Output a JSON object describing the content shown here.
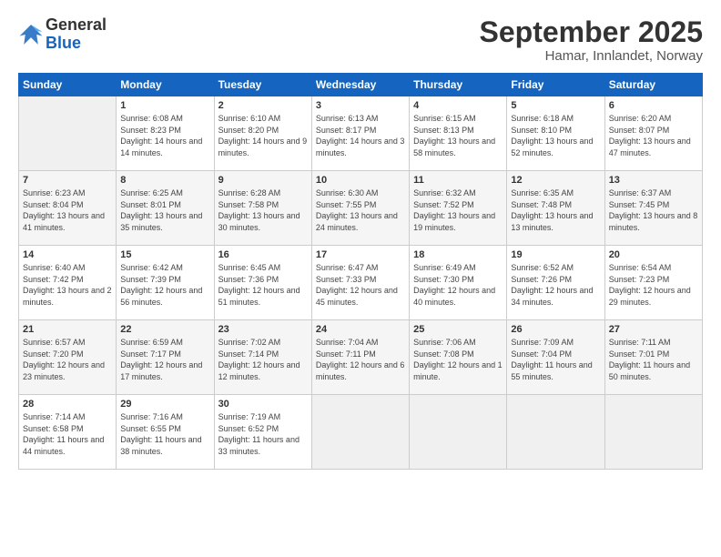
{
  "logo": {
    "general": "General",
    "blue": "Blue"
  },
  "header": {
    "month": "September 2025",
    "location": "Hamar, Innlandet, Norway"
  },
  "days_header": [
    "Sunday",
    "Monday",
    "Tuesday",
    "Wednesday",
    "Thursday",
    "Friday",
    "Saturday"
  ],
  "weeks": [
    [
      {
        "num": "",
        "sunrise": "",
        "sunset": "",
        "daylight": ""
      },
      {
        "num": "1",
        "sunrise": "Sunrise: 6:08 AM",
        "sunset": "Sunset: 8:23 PM",
        "daylight": "Daylight: 14 hours and 14 minutes."
      },
      {
        "num": "2",
        "sunrise": "Sunrise: 6:10 AM",
        "sunset": "Sunset: 8:20 PM",
        "daylight": "Daylight: 14 hours and 9 minutes."
      },
      {
        "num": "3",
        "sunrise": "Sunrise: 6:13 AM",
        "sunset": "Sunset: 8:17 PM",
        "daylight": "Daylight: 14 hours and 3 minutes."
      },
      {
        "num": "4",
        "sunrise": "Sunrise: 6:15 AM",
        "sunset": "Sunset: 8:13 PM",
        "daylight": "Daylight: 13 hours and 58 minutes."
      },
      {
        "num": "5",
        "sunrise": "Sunrise: 6:18 AM",
        "sunset": "Sunset: 8:10 PM",
        "daylight": "Daylight: 13 hours and 52 minutes."
      },
      {
        "num": "6",
        "sunrise": "Sunrise: 6:20 AM",
        "sunset": "Sunset: 8:07 PM",
        "daylight": "Daylight: 13 hours and 47 minutes."
      }
    ],
    [
      {
        "num": "7",
        "sunrise": "Sunrise: 6:23 AM",
        "sunset": "Sunset: 8:04 PM",
        "daylight": "Daylight: 13 hours and 41 minutes."
      },
      {
        "num": "8",
        "sunrise": "Sunrise: 6:25 AM",
        "sunset": "Sunset: 8:01 PM",
        "daylight": "Daylight: 13 hours and 35 minutes."
      },
      {
        "num": "9",
        "sunrise": "Sunrise: 6:28 AM",
        "sunset": "Sunset: 7:58 PM",
        "daylight": "Daylight: 13 hours and 30 minutes."
      },
      {
        "num": "10",
        "sunrise": "Sunrise: 6:30 AM",
        "sunset": "Sunset: 7:55 PM",
        "daylight": "Daylight: 13 hours and 24 minutes."
      },
      {
        "num": "11",
        "sunrise": "Sunrise: 6:32 AM",
        "sunset": "Sunset: 7:52 PM",
        "daylight": "Daylight: 13 hours and 19 minutes."
      },
      {
        "num": "12",
        "sunrise": "Sunrise: 6:35 AM",
        "sunset": "Sunset: 7:48 PM",
        "daylight": "Daylight: 13 hours and 13 minutes."
      },
      {
        "num": "13",
        "sunrise": "Sunrise: 6:37 AM",
        "sunset": "Sunset: 7:45 PM",
        "daylight": "Daylight: 13 hours and 8 minutes."
      }
    ],
    [
      {
        "num": "14",
        "sunrise": "Sunrise: 6:40 AM",
        "sunset": "Sunset: 7:42 PM",
        "daylight": "Daylight: 13 hours and 2 minutes."
      },
      {
        "num": "15",
        "sunrise": "Sunrise: 6:42 AM",
        "sunset": "Sunset: 7:39 PM",
        "daylight": "Daylight: 12 hours and 56 minutes."
      },
      {
        "num": "16",
        "sunrise": "Sunrise: 6:45 AM",
        "sunset": "Sunset: 7:36 PM",
        "daylight": "Daylight: 12 hours and 51 minutes."
      },
      {
        "num": "17",
        "sunrise": "Sunrise: 6:47 AM",
        "sunset": "Sunset: 7:33 PM",
        "daylight": "Daylight: 12 hours and 45 minutes."
      },
      {
        "num": "18",
        "sunrise": "Sunrise: 6:49 AM",
        "sunset": "Sunset: 7:30 PM",
        "daylight": "Daylight: 12 hours and 40 minutes."
      },
      {
        "num": "19",
        "sunrise": "Sunrise: 6:52 AM",
        "sunset": "Sunset: 7:26 PM",
        "daylight": "Daylight: 12 hours and 34 minutes."
      },
      {
        "num": "20",
        "sunrise": "Sunrise: 6:54 AM",
        "sunset": "Sunset: 7:23 PM",
        "daylight": "Daylight: 12 hours and 29 minutes."
      }
    ],
    [
      {
        "num": "21",
        "sunrise": "Sunrise: 6:57 AM",
        "sunset": "Sunset: 7:20 PM",
        "daylight": "Daylight: 12 hours and 23 minutes."
      },
      {
        "num": "22",
        "sunrise": "Sunrise: 6:59 AM",
        "sunset": "Sunset: 7:17 PM",
        "daylight": "Daylight: 12 hours and 17 minutes."
      },
      {
        "num": "23",
        "sunrise": "Sunrise: 7:02 AM",
        "sunset": "Sunset: 7:14 PM",
        "daylight": "Daylight: 12 hours and 12 minutes."
      },
      {
        "num": "24",
        "sunrise": "Sunrise: 7:04 AM",
        "sunset": "Sunset: 7:11 PM",
        "daylight": "Daylight: 12 hours and 6 minutes."
      },
      {
        "num": "25",
        "sunrise": "Sunrise: 7:06 AM",
        "sunset": "Sunset: 7:08 PM",
        "daylight": "Daylight: 12 hours and 1 minute."
      },
      {
        "num": "26",
        "sunrise": "Sunrise: 7:09 AM",
        "sunset": "Sunset: 7:04 PM",
        "daylight": "Daylight: 11 hours and 55 minutes."
      },
      {
        "num": "27",
        "sunrise": "Sunrise: 7:11 AM",
        "sunset": "Sunset: 7:01 PM",
        "daylight": "Daylight: 11 hours and 50 minutes."
      }
    ],
    [
      {
        "num": "28",
        "sunrise": "Sunrise: 7:14 AM",
        "sunset": "Sunset: 6:58 PM",
        "daylight": "Daylight: 11 hours and 44 minutes."
      },
      {
        "num": "29",
        "sunrise": "Sunrise: 7:16 AM",
        "sunset": "Sunset: 6:55 PM",
        "daylight": "Daylight: 11 hours and 38 minutes."
      },
      {
        "num": "30",
        "sunrise": "Sunrise: 7:19 AM",
        "sunset": "Sunset: 6:52 PM",
        "daylight": "Daylight: 11 hours and 33 minutes."
      },
      {
        "num": "",
        "sunrise": "",
        "sunset": "",
        "daylight": ""
      },
      {
        "num": "",
        "sunrise": "",
        "sunset": "",
        "daylight": ""
      },
      {
        "num": "",
        "sunrise": "",
        "sunset": "",
        "daylight": ""
      },
      {
        "num": "",
        "sunrise": "",
        "sunset": "",
        "daylight": ""
      }
    ]
  ]
}
